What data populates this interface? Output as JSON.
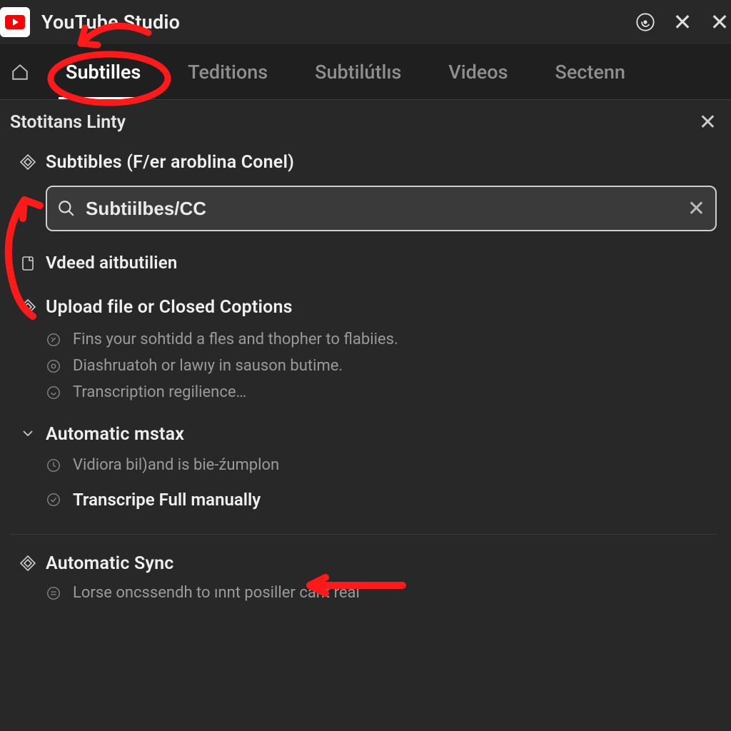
{
  "app_title": "YouTube Studio",
  "tabs": {
    "t0": "Subtilles",
    "t1": "Teditions",
    "t2": "Subtilútlıs",
    "t3": "Videos",
    "t4": "Sectenn"
  },
  "panel_title": "Stotitans Linty",
  "section_subtitles": "Subtibles (F/er aroblina Conel)",
  "search_value": "Subtiilbes/CC",
  "row_vdeed": "Vdeed aitbutilien",
  "upload": {
    "title": "Upload file or Closed Coptions",
    "line1": "Fins your sohtidd a fles and thopher to flabiies.",
    "line2": "Diashruatoh or lawıy in sauson butime.",
    "line3": "Transcription regilience…"
  },
  "auto": {
    "title": "Automatic mstax",
    "line1": "Vidiora bil)and is bie-źumplon",
    "manual": "Transcripe Full manually"
  },
  "sync": {
    "title": "Automatic Sync",
    "line1": "Lorse onсssendh to ınnt posiller cant real"
  },
  "colors": {
    "annotation": "#ff1a1a"
  }
}
